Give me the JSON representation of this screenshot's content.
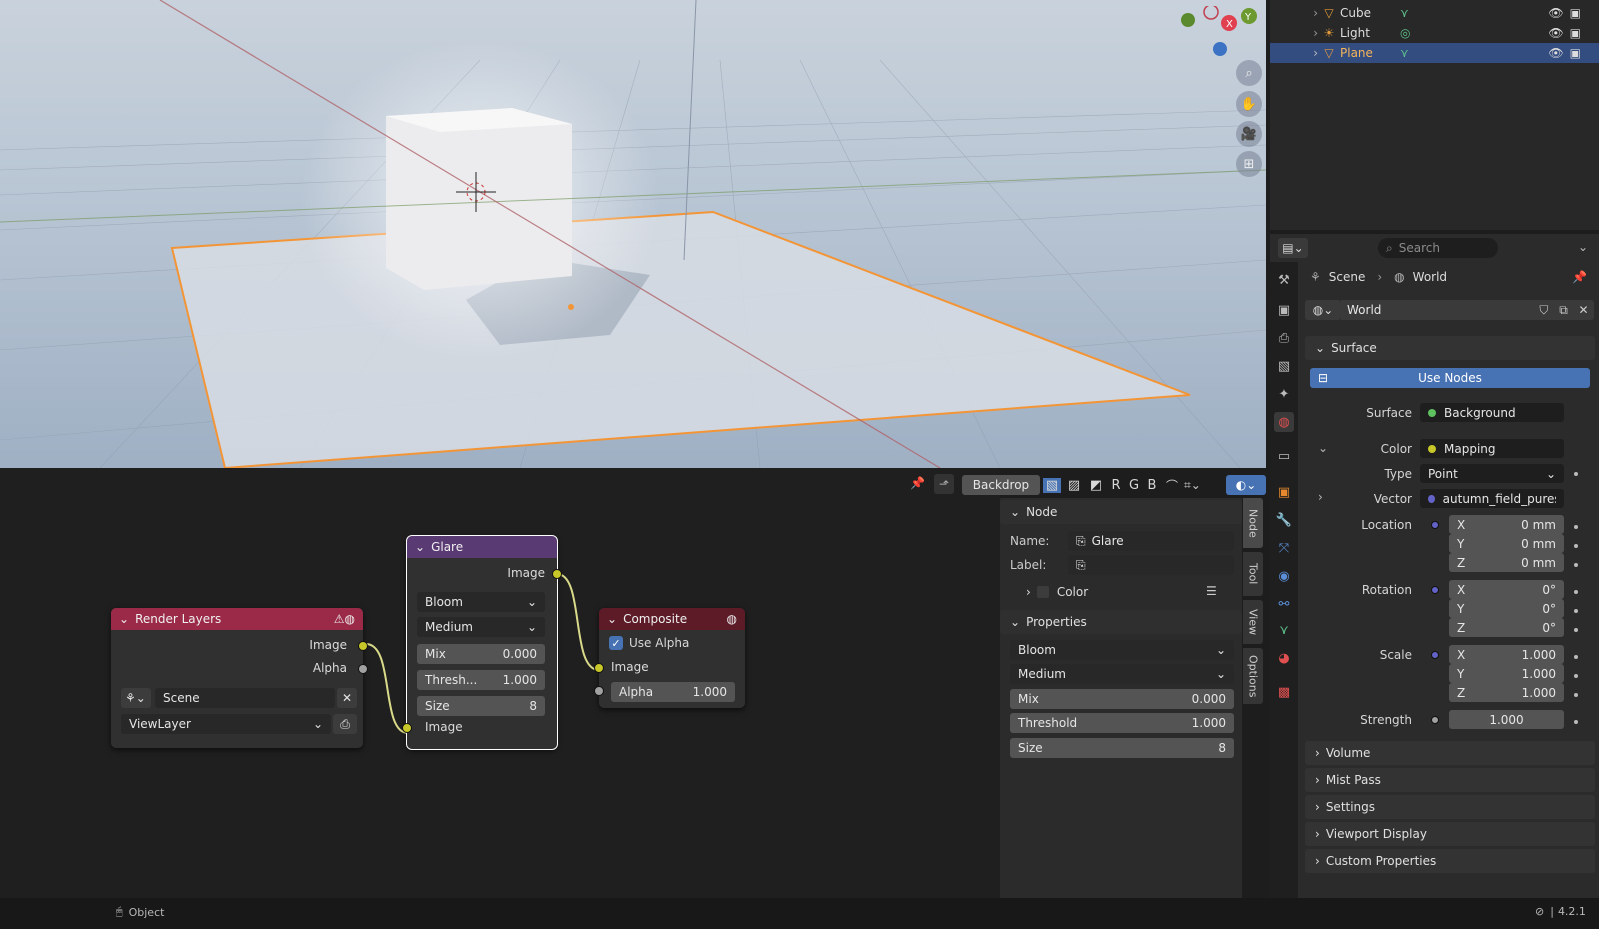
{
  "outliner": {
    "rows": [
      {
        "name": "Cube",
        "selected": false
      },
      {
        "name": "Light",
        "selected": false
      },
      {
        "name": "Plane",
        "selected": true
      }
    ]
  },
  "node_editor": {
    "header": {
      "backdrop_label": "Backdrop",
      "channels": [
        "R",
        "G",
        "B"
      ]
    },
    "nodes": {
      "render_layers": {
        "title": "Render Layers",
        "outputs": [
          "Image",
          "Alpha"
        ],
        "scene": "Scene",
        "view_layer": "ViewLayer"
      },
      "glare": {
        "title": "Glare",
        "output": "Image",
        "type": "Bloom",
        "quality": "Medium",
        "mix_label": "Mix",
        "mix_value": "0.000",
        "thresh_label": "Thresh...",
        "thresh_value": "1.000",
        "size_label": "Size",
        "size_value": "8",
        "input": "Image"
      },
      "composite": {
        "title": "Composite",
        "use_alpha": "Use Alpha",
        "input_image": "Image",
        "alpha_label": "Alpha",
        "alpha_value": "1.000"
      }
    }
  },
  "npanel": {
    "node_section": "Node",
    "name_label": "Name:",
    "name_value": "Glare",
    "label_label": "Label:",
    "color_label": "Color",
    "properties_section": "Properties",
    "type": "Bloom",
    "quality": "Medium",
    "mix_label": "Mix",
    "mix_value": "0.000",
    "threshold_label": "Threshold",
    "threshold_value": "1.000",
    "size_label": "Size",
    "size_value": "8",
    "tabs": [
      "Node",
      "Tool",
      "View",
      "Options"
    ]
  },
  "properties": {
    "search_placeholder": "Search",
    "breadcrumb": [
      "Scene",
      "World"
    ],
    "world_name": "World",
    "surface_section": "Surface",
    "use_nodes": "Use Nodes",
    "surface_label": "Surface",
    "surface_value": "Background",
    "color_label": "Color",
    "color_value": "Mapping",
    "type_label": "Type",
    "type_value": "Point",
    "vector_label": "Vector",
    "vector_value": "autumn_field_puresk...",
    "location_label": "Location",
    "location": [
      "0 mm",
      "0 mm",
      "0 mm"
    ],
    "rotation_label": "Rotation",
    "rotation": [
      "0°",
      "0°",
      "0°"
    ],
    "scale_label": "Scale",
    "scale": [
      "1.000",
      "1.000",
      "1.000"
    ],
    "axis_labels": [
      "X",
      "Y",
      "Z"
    ],
    "strength_label": "Strength",
    "strength_value": "1.000",
    "collapsed_sections": [
      "Volume",
      "Mist Pass",
      "Settings",
      "Viewport Display",
      "Custom Properties"
    ]
  },
  "statusbar": {
    "mode": "Object",
    "version": "4.2.1"
  },
  "colors": {
    "accent_blue": "#4772b3",
    "selection_orange": "#f39536",
    "socket_yellow": "#c7c729",
    "render_layers_header": "#9a2a48",
    "glare_header": "#5a3a73",
    "composite_header": "#5c1b27"
  }
}
